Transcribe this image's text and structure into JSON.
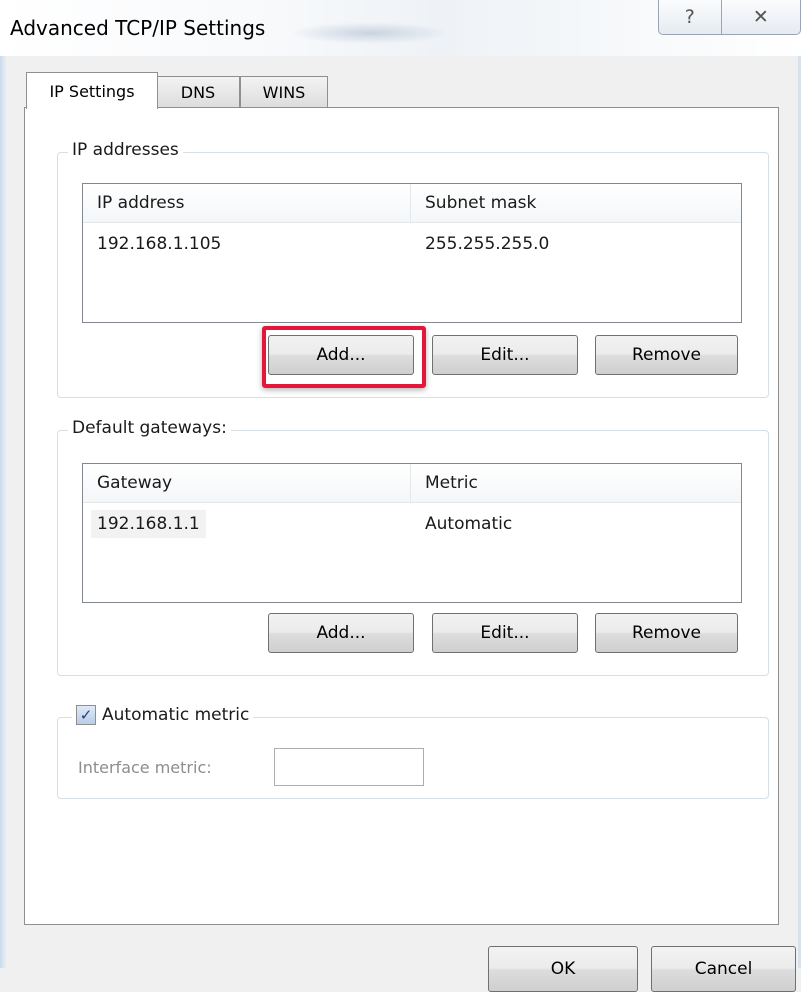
{
  "window": {
    "title": "Advanced TCP/IP Settings",
    "help_glyph": "?",
    "close_glyph": "✕"
  },
  "tabs": [
    {
      "label": "IP Settings",
      "active": true
    },
    {
      "label": "DNS",
      "active": false
    },
    {
      "label": "WINS",
      "active": false
    }
  ],
  "ip_addresses": {
    "legend": "IP addresses",
    "columns": [
      "IP address",
      "Subnet mask"
    ],
    "rows": [
      {
        "ip": "192.168.1.105",
        "mask": "255.255.255.0"
      }
    ],
    "buttons": {
      "add": "Add...",
      "edit": "Edit...",
      "remove": "Remove"
    }
  },
  "default_gateways": {
    "legend": "Default gateways:",
    "columns": [
      "Gateway",
      "Metric"
    ],
    "rows": [
      {
        "gateway": "192.168.1.1",
        "metric": "Automatic"
      }
    ],
    "buttons": {
      "add": "Add...",
      "edit": "Edit...",
      "remove": "Remove"
    }
  },
  "metric": {
    "checkbox_label": "Automatic metric",
    "checked": true,
    "check_glyph": "✓",
    "interface_label": "Interface metric:",
    "interface_value": ""
  },
  "footer": {
    "ok": "OK",
    "cancel": "Cancel"
  },
  "colors": {
    "highlight": "#e3163b",
    "panel_border": "#8e8f8f"
  }
}
